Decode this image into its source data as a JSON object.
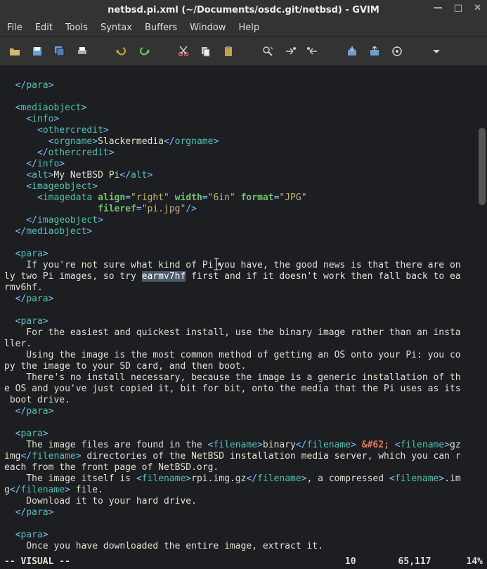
{
  "window": {
    "title": "netbsd.pi.xml (~/Documents/osdc.git/netbsd) - GVIM",
    "minimize": "—",
    "maximize": "□",
    "close": "✕"
  },
  "menu": {
    "file": "File",
    "edit": "Edit",
    "tools": "Tools",
    "syntax": "Syntax",
    "buffers": "Buffers",
    "window": "Window",
    "help": "Help"
  },
  "status": {
    "mode": "-- VISUAL --",
    "col1": "10",
    "col2": "65,117",
    "col3": "14%"
  },
  "code": {
    "l1_a": "  </",
    "l1_b": "para",
    "l1_c": ">",
    "l3_a": "  <",
    "l3_b": "mediaobject",
    "l3_c": ">",
    "l4_a": "    <",
    "l4_b": "info",
    "l4_c": ">",
    "l5_a": "      <",
    "l5_b": "othercredit",
    "l5_c": ">",
    "l6_a": "        <",
    "l6_b": "orgname",
    "l6_c": ">",
    "l6_d": "Slackermedia",
    "l6_e": "</",
    "l6_f": "orgname",
    "l6_g": ">",
    "l7_a": "      </",
    "l7_b": "othercredit",
    "l7_c": ">",
    "l8_a": "    </",
    "l8_b": "info",
    "l8_c": ">",
    "l9_a": "    <",
    "l9_b": "alt",
    "l9_c": ">",
    "l9_d": "My NetBSD Pi",
    "l9_e": "</",
    "l9_f": "alt",
    "l9_g": ">",
    "l10_a": "    <",
    "l10_b": "imageobject",
    "l10_c": ">",
    "l11_a": "      <",
    "l11_b": "imagedata",
    "l11_c": " ",
    "l11_d": "align",
    "l11_e": "=",
    "l11_f": "\"right\"",
    "l11_g": " ",
    "l11_h": "width",
    "l11_i": "=",
    "l11_j": "\"6in\"",
    "l11_k": " ",
    "l11_l": "format",
    "l11_m": "=",
    "l11_n": "\"JPG\"",
    "l12_a": "                 ",
    "l12_b": "fileref",
    "l12_c": "=",
    "l12_d": "\"pi.jpg\"",
    "l12_e": "/>",
    "l13_a": "    </",
    "l13_b": "imageobject",
    "l13_c": ">",
    "l14_a": "  </",
    "l14_b": "mediaobject",
    "l14_c": ">",
    "l16_a": "  <",
    "l16_b": "para",
    "l16_c": ">",
    "l17": "    If you're not sure what kind of Pi you have, the good news is that there are on",
    "l18_a": "ly two Pi images, so try ",
    "l18_sel": "earmv7hf",
    "l18_b": " first and if it doesn't work then fall back to ea",
    "l19": "rmv6hf.",
    "l20_a": "  </",
    "l20_b": "para",
    "l20_c": ">",
    "l22_a": "  <",
    "l22_b": "para",
    "l22_c": ">",
    "l23": "    For the easiest and quickest install, use the binary image rather than an insta",
    "l24": "ller.",
    "l25": "    Using the image is the most common method of getting an OS onto your Pi: you co",
    "l26": "py the image to your SD card, and then boot.",
    "l27": "    There's no install necessary, because the image is a generic installation of th",
    "l28": "e OS and you've just copied it, bit for bit, onto the media that the Pi uses as its",
    "l29": " boot drive.",
    "l30_a": "  </",
    "l30_b": "para",
    "l30_c": ">",
    "l32_a": "  <",
    "l32_b": "para",
    "l32_c": ">",
    "l33_a": "    The image files are found in the ",
    "l33_b": "<",
    "l33_c": "filename",
    "l33_d": ">",
    "l33_e": "binary",
    "l33_f": "</",
    "l33_g": "filename",
    "l33_h": ">",
    "l33_i": " ",
    "l33_j": "&#62;",
    "l33_k": " ",
    "l33_l": "<",
    "l33_m": "filename",
    "l33_n": ">",
    "l33_o": "gz",
    "l34_a": "img",
    "l34_b": "</",
    "l34_c": "filename",
    "l34_d": ">",
    "l34_e": " directories of the NetBSD installation media server, which you can r",
    "l35": "each from the front page of NetBSD.org.",
    "l36_a": "    The image itself is ",
    "l36_b": "<",
    "l36_c": "filename",
    "l36_d": ">",
    "l36_e": "rpi.img.gz",
    "l36_f": "</",
    "l36_g": "filename",
    "l36_h": ">",
    "l36_i": ", a compressed ",
    "l36_j": "<",
    "l36_k": "filename",
    "l36_l": ">",
    "l36_m": ".im",
    "l37_a": "g",
    "l37_b": "</",
    "l37_c": "filename",
    "l37_d": ">",
    "l37_e": " file.",
    "l38": "    Download it to your hard drive.",
    "l39_a": "  </",
    "l39_b": "para",
    "l39_c": ">",
    "l41_a": "  <",
    "l41_b": "para",
    "l41_c": ">",
    "l42": "    Once you have downloaded the entire image, extract it."
  }
}
